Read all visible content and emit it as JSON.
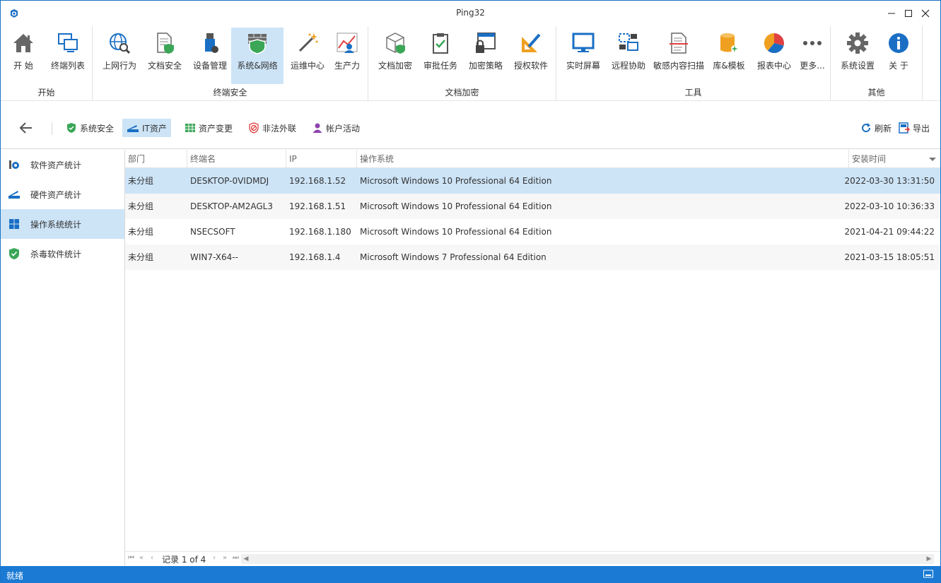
{
  "window": {
    "title": "Ping32"
  },
  "ribbon": {
    "groups": [
      {
        "label": "开始"
      },
      {
        "label": "终端安全"
      },
      {
        "label": "文档加密"
      },
      {
        "label": "工具"
      },
      {
        "label": "其他"
      }
    ],
    "buttons": {
      "start": "开 始",
      "terminal_list": "终端列表",
      "web_behavior": "上网行为",
      "doc_security": "文档安全",
      "device_mgmt": "设备管理",
      "sys_network": "系统&网络",
      "ops_center": "运维中心",
      "productivity": "生产力",
      "doc_encrypt": "文档加密",
      "approval_task": "审批任务",
      "encrypt_policy": "加密策略",
      "auth_software": "授权软件",
      "realtime_screen": "实时屏幕",
      "remote_assist": "远程协助",
      "sensitive_scan": "敏感内容扫描",
      "library_template": "库&模板",
      "report_center": "报表中心",
      "more": "更多...",
      "sys_settings": "系统设置",
      "about": "关 于"
    }
  },
  "subbar": {
    "items": [
      {
        "label": "系统安全"
      },
      {
        "label": "IT资产"
      },
      {
        "label": "资产变更"
      },
      {
        "label": "非法外联"
      },
      {
        "label": "帐户活动"
      }
    ],
    "refresh": "刷新",
    "export": "导出"
  },
  "leftnav": {
    "items": [
      {
        "label": "软件资产统计"
      },
      {
        "label": "硬件资产统计"
      },
      {
        "label": "操作系统统计"
      },
      {
        "label": "杀毒软件统计"
      }
    ]
  },
  "grid": {
    "columns": [
      "部门",
      "终端名",
      "IP",
      "操作系统",
      "安装时间"
    ],
    "rows": [
      {
        "dept": "未分组",
        "name": "DESKTOP-0VIDMDJ",
        "ip": "192.168.1.52",
        "os": "Microsoft Windows 10 Professional 64 Edition",
        "time": "2022-03-30 13:31:50"
      },
      {
        "dept": "未分组",
        "name": "DESKTOP-AM2AGL3",
        "ip": "192.168.1.51",
        "os": "Microsoft Windows 10 Professional 64 Edition",
        "time": "2022-03-10 10:36:33"
      },
      {
        "dept": "未分组",
        "name": "NSECSOFT",
        "ip": "192.168.1.180",
        "os": "Microsoft Windows 10 Professional 64 Edition",
        "time": "2021-04-21 09:44:22"
      },
      {
        "dept": "未分组",
        "name": "WIN7-X64--",
        "ip": "192.168.1.4",
        "os": "Microsoft Windows 7 Professional 64 Edition",
        "time": "2021-03-15 18:05:51"
      }
    ]
  },
  "pager": {
    "text": "记录 1 of 4"
  },
  "status": {
    "text": "就绪"
  },
  "colors": {
    "accent": "#1a7ad4",
    "selection": "#cde4f7"
  }
}
